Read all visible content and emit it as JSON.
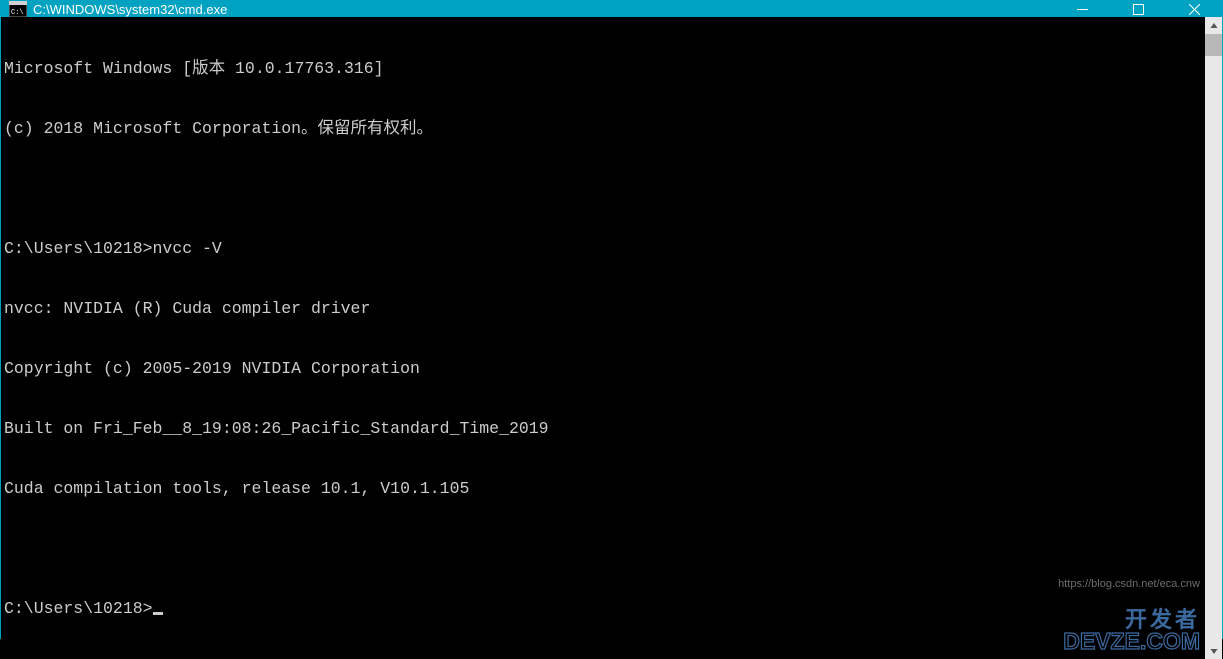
{
  "window": {
    "title": "C:\\WINDOWS\\system32\\cmd.exe"
  },
  "terminal": {
    "lines": [
      "Microsoft Windows [版本 10.0.17763.316]",
      "(c) 2018 Microsoft Corporation。保留所有权利。",
      "",
      "C:\\Users\\10218>nvcc -V",
      "nvcc: NVIDIA (R) Cuda compiler driver",
      "Copyright (c) 2005-2019 NVIDIA Corporation",
      "Built on Fri_Feb__8_19:08:26_Pacific_Standard_Time_2019",
      "Cuda compilation tools, release 10.1, V10.1.105",
      ""
    ],
    "prompt": "C:\\Users\\10218>"
  },
  "watermark": {
    "cn": "开发者",
    "en": "DEVZE.COM",
    "url": "https://blog.csdn.net/eca.cnw"
  }
}
